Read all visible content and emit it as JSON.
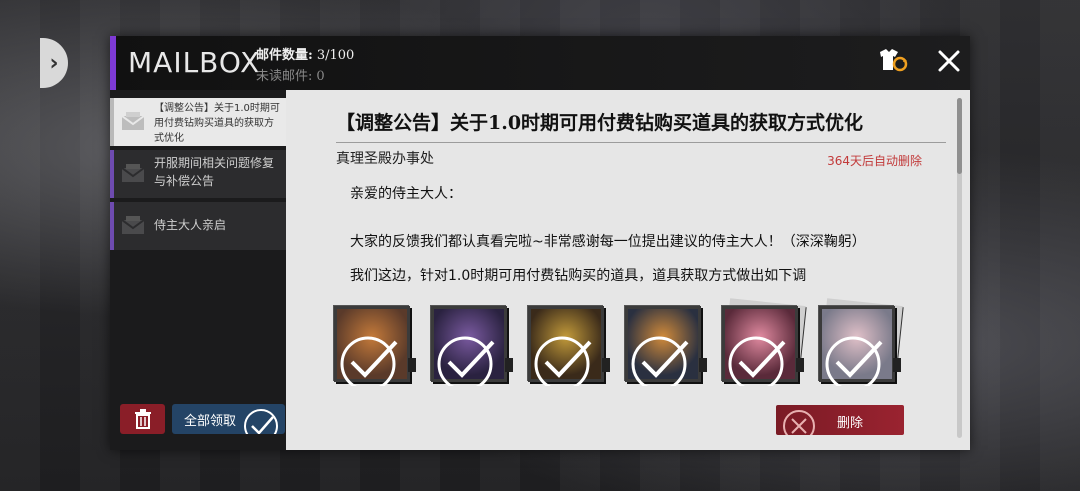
{
  "header": {
    "title": "MAILBOX",
    "count_label": "邮件数量:",
    "count_value": "3/100",
    "unread_label": "未读邮件:",
    "unread_value": "0"
  },
  "mail_list": [
    {
      "label": "【调整公告】关于1.0时期可用付费钻购买道具的获取方式优化",
      "active": true
    },
    {
      "label": "开服期间相关问题修复与补偿公告",
      "active": false
    },
    {
      "label": "侍主大人亲启",
      "active": false
    }
  ],
  "sidebar_buttons": {
    "claim_all_label": "全部领取"
  },
  "detail": {
    "title": "【调整公告】关于1.0时期可用付费钻购买道具的获取方式优化",
    "sender": "真理圣殿办事处",
    "expire": "364天后自动删除",
    "body": [
      "亲爱的侍主大人：",
      "大家的反馈我们都认真看完啦~非常感谢每一位提出建议的侍主大人！（深深鞠躬）",
      "我们这边，针对1.0时期可用付费钻购买的道具，道具获取方式做出如下调"
    ],
    "attachments": [
      {
        "name": "attachment-item-1",
        "claimed": true,
        "colors": [
          "#5a3a2a",
          "#c47a3a"
        ]
      },
      {
        "name": "attachment-item-2",
        "claimed": true,
        "colors": [
          "#2a2240",
          "#7a5aa0"
        ]
      },
      {
        "name": "attachment-item-3",
        "claimed": true,
        "colors": [
          "#3a2a1a",
          "#c29a3a"
        ]
      },
      {
        "name": "attachment-item-4",
        "claimed": true,
        "colors": [
          "#2a3040",
          "#d08a3a"
        ]
      },
      {
        "name": "attachment-item-5",
        "claimed": true,
        "colors": [
          "#5a2a3a",
          "#e08aa0"
        ]
      },
      {
        "name": "attachment-item-6",
        "claimed": true,
        "colors": [
          "#7a7a8a",
          "#e0c0c8"
        ]
      }
    ],
    "delete_label": "删除"
  },
  "colors": {
    "accent_purple": "#7e3ad4",
    "delete_red": "#8a1e28",
    "claim_blue": "#244466",
    "expire_red": "#c23a3a"
  }
}
